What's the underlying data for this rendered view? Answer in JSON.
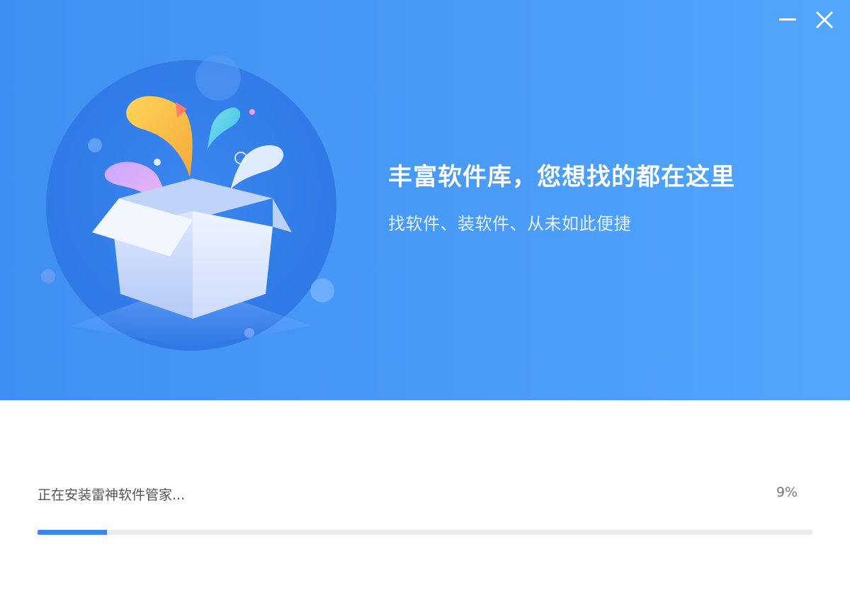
{
  "window": {
    "controls": {
      "minimize_icon": "minimize-icon",
      "close_icon": "close-icon"
    }
  },
  "banner": {
    "headline": "丰富软件库，您想找的都在这里",
    "subline": "找软件、装软件、从未如此便捷",
    "illustration": "gift-box-icon"
  },
  "progress": {
    "status_text": "正在安装雷神软件管家...",
    "percent_text": "9%",
    "value": 0.09
  },
  "colors": {
    "banner_blue": "#4a9cf8",
    "progress_fill": "#3d86ec",
    "progress_track": "#ebebeb"
  }
}
